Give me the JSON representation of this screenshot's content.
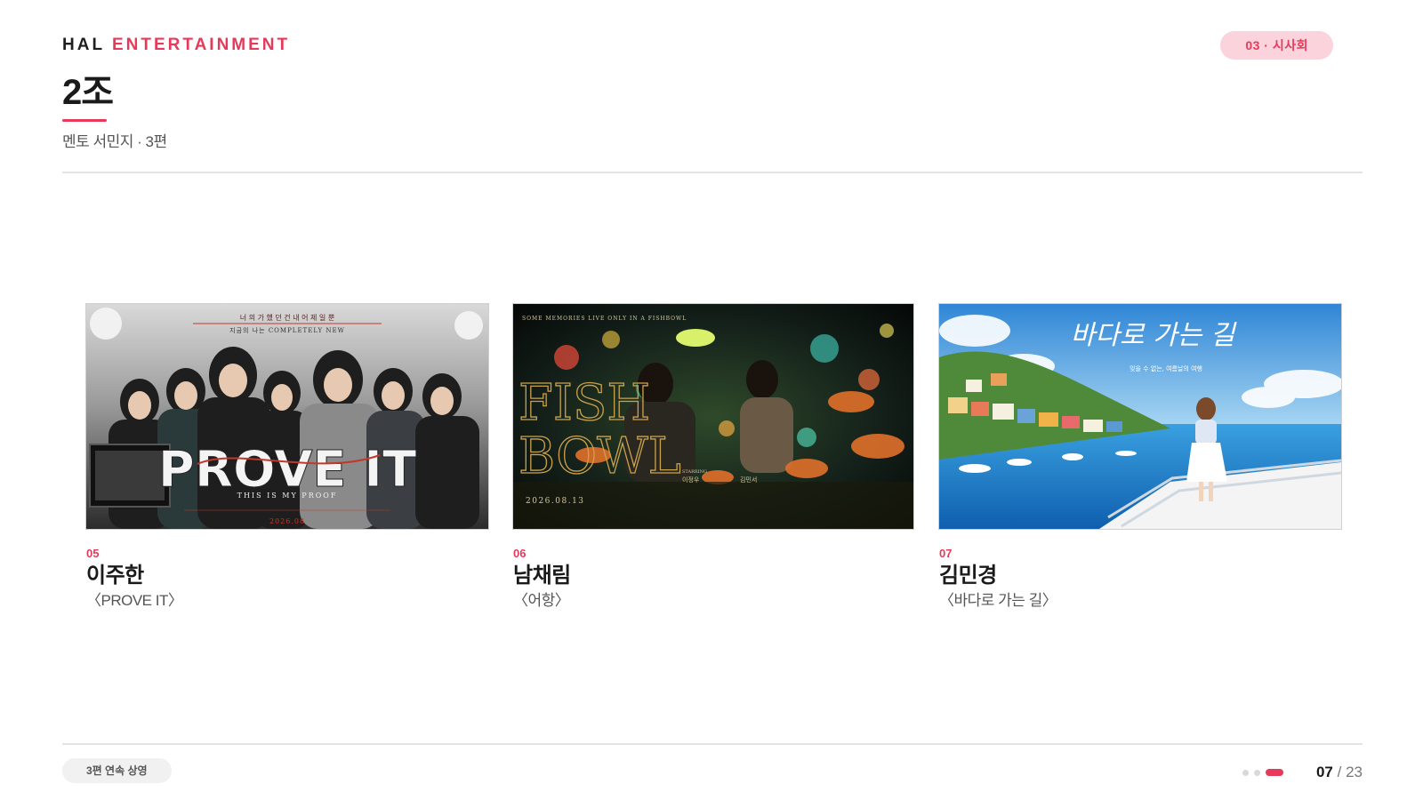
{
  "header": {
    "brand_primary": "HAL",
    "brand_secondary": "ENTERTAINMENT",
    "section_badge": "03 · 시사회",
    "title": "2조",
    "subtitle": "멘토 서민지 · 3편"
  },
  "films": [
    {
      "number": "05",
      "director": "이주한",
      "title": "〈PROVE IT〉",
      "poster": {
        "headline": "PROVE IT",
        "tagline": "THIS IS MY PROOF",
        "top_line_1": "너 의 가   했 던   건   내   어 제 일 뿐",
        "top_line_2": "지금의 나는 COMPLETELY NEW",
        "date": "2026.08"
      }
    },
    {
      "number": "06",
      "director": "남채림",
      "title": "〈어항〉",
      "poster": {
        "headline_line_1": "FISH",
        "headline_line_2": "BOWL",
        "date": "2026.08.13",
        "starring_label": "STARRING",
        "cast_1": "이정우",
        "cast_2": "김민서",
        "top_left": "SOME MEMORIES LIVE ONLY IN A FISHBOWL"
      }
    },
    {
      "number": "07",
      "director": "김민경",
      "title": "〈바다로 가는 길〉",
      "poster": {
        "headline": "바다로 가는 길",
        "tagline": "잊을 수 없는, 여름날의 여행"
      }
    }
  ],
  "footer": {
    "badge": "3편 연속 상영",
    "page_current": "07",
    "page_separator": "/",
    "page_total": "23"
  },
  "colors": {
    "accent": "#e63a5a",
    "accent_soft": "#fbd3dc",
    "divider": "#e3e3e3"
  }
}
